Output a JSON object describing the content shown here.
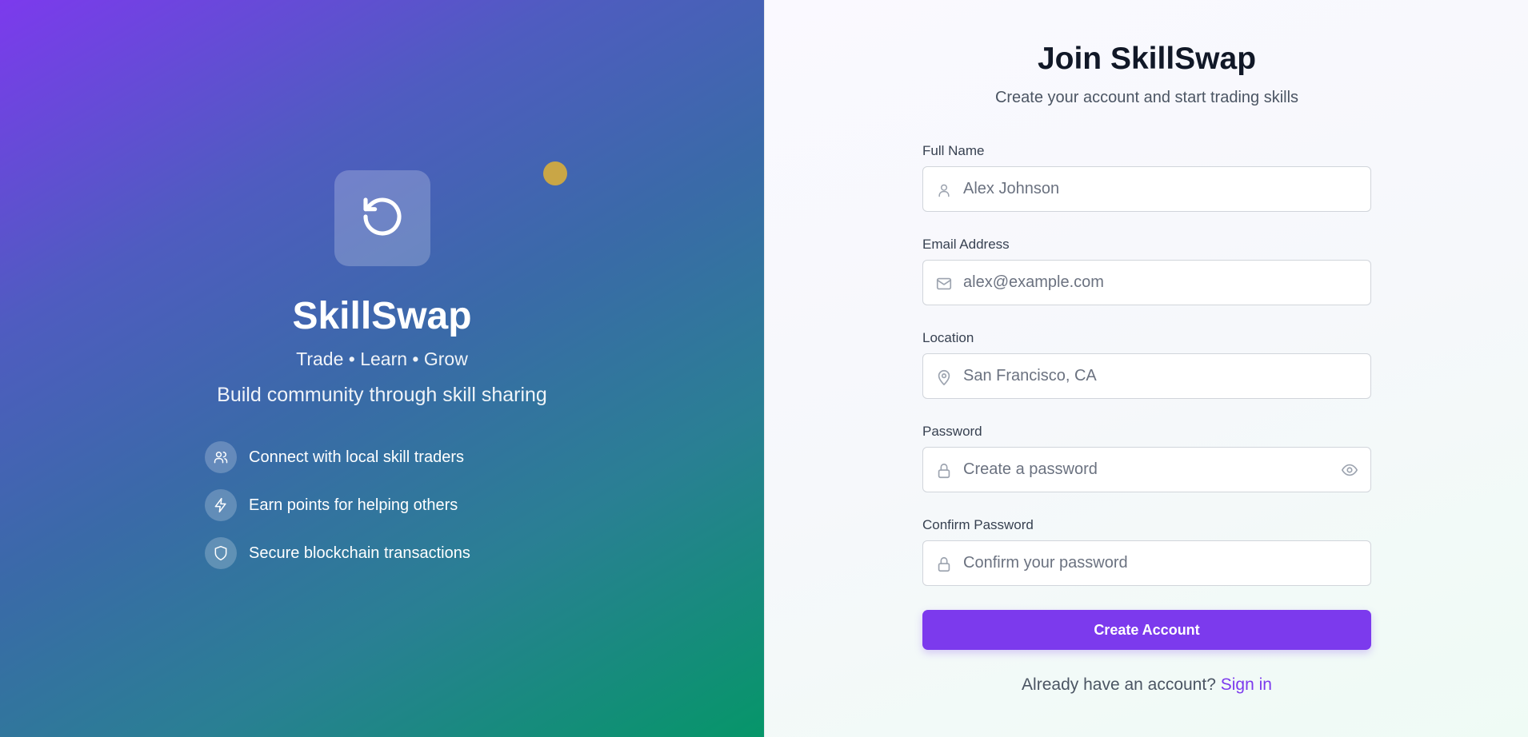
{
  "colors": {
    "accent": "#7c3aed",
    "accent_dot": "#c9a646",
    "link": "#7c3aed"
  },
  "brand": {
    "logo_icon": "rotate-ccw-icon",
    "name": "SkillSwap",
    "tagline": "Trade • Learn • Grow",
    "subtitle": "Build community through skill sharing",
    "features": [
      {
        "icon": "users-icon",
        "text": "Connect with local skill traders"
      },
      {
        "icon": "lightning-icon",
        "text": "Earn points for helping others"
      },
      {
        "icon": "shield-icon",
        "text": "Secure blockchain transactions"
      }
    ]
  },
  "form": {
    "title": "Join SkillSwap",
    "subtitle": "Create your account and start trading skills",
    "fields": {
      "full_name": {
        "label": "Full Name",
        "placeholder": "Alex Johnson",
        "value": "",
        "icon": "user-icon"
      },
      "email": {
        "label": "Email Address",
        "placeholder": "alex@example.com",
        "value": "",
        "icon": "mail-icon"
      },
      "location": {
        "label": "Location",
        "placeholder": "San Francisco, CA",
        "value": "",
        "icon": "map-pin-icon"
      },
      "password": {
        "label": "Password",
        "placeholder": "Create a password",
        "value": "",
        "icon": "lock-icon",
        "toggle_icon": "eye-icon"
      },
      "confirm_password": {
        "label": "Confirm Password",
        "placeholder": "Confirm your password",
        "value": "",
        "icon": "lock-icon"
      }
    },
    "submit_label": "Create Account",
    "signin_prompt": "Already have an account?",
    "signin_link": "Sign in"
  }
}
